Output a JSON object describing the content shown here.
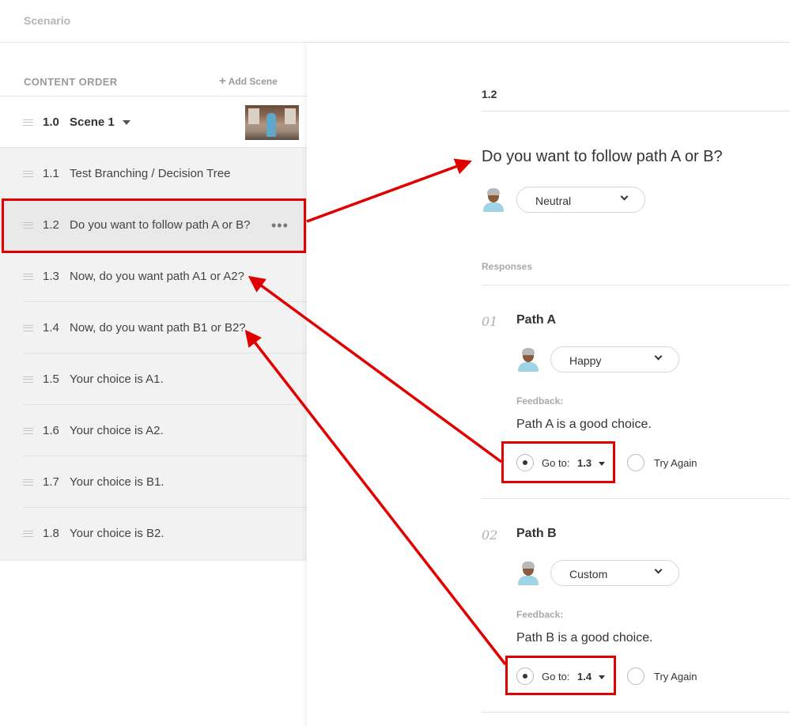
{
  "topbar": {
    "title": "Scenario"
  },
  "sidebar": {
    "header_label": "CONTENT ORDER",
    "add_scene_label": "Add Scene",
    "scene": {
      "number": "1.0",
      "name": "Scene 1"
    },
    "items": [
      {
        "number": "1.1",
        "text": "Test Branching / Decision Tree"
      },
      {
        "number": "1.2",
        "text": "Do you want to follow path A or B?"
      },
      {
        "number": "1.3",
        "text": "Now, do you want path A1 or A2?"
      },
      {
        "number": "1.4",
        "text": "Now, do you want path B1 or B2?"
      },
      {
        "number": "1.5",
        "text": "Your choice is A1."
      },
      {
        "number": "1.6",
        "text": "Your choice is A2."
      },
      {
        "number": "1.7",
        "text": "Your choice is B1."
      },
      {
        "number": "1.8",
        "text": "Your choice is B2."
      }
    ]
  },
  "main": {
    "crumb": "1.2",
    "question": "Do you want to follow path A or B?",
    "question_emotion": "Neutral",
    "responses_label": "Responses",
    "responses": [
      {
        "index": "01",
        "title": "Path A",
        "emotion": "Happy",
        "feedback_label": "Feedback:",
        "feedback": "Path A is a good choice.",
        "goto_label": "Go to:",
        "goto_value": "1.3",
        "try_again_label": "Try Again"
      },
      {
        "index": "02",
        "title": "Path B",
        "emotion": "Custom",
        "feedback_label": "Feedback:",
        "feedback": "Path B is a good choice.",
        "goto_label": "Go to:",
        "goto_value": "1.4",
        "try_again_label": "Try Again"
      }
    ]
  },
  "colors": {
    "annotation": "#e00000",
    "selected_row": "#e9e9e9",
    "list_bg": "#f2f2f2"
  }
}
